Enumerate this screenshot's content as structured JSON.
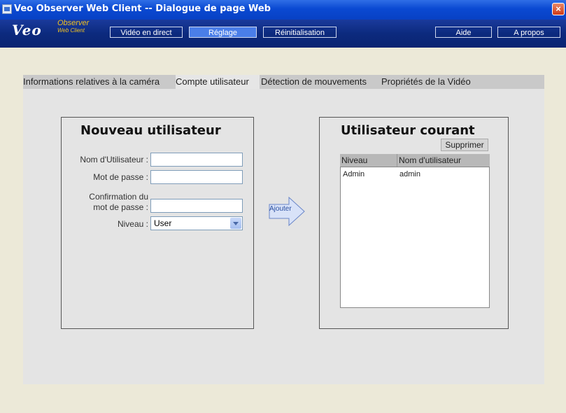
{
  "window": {
    "title": "Veo Observer Web Client -- Dialogue de page Web",
    "close_label": "×"
  },
  "logo": {
    "brand": "Veo",
    "line1": "Observer",
    "line2": "Web Client"
  },
  "nav": {
    "live_video": "Vidéo en direct",
    "settings": "Réglage",
    "reset": "Réinitialisation",
    "help": "Aide",
    "about": "A propos"
  },
  "tabs": [
    {
      "label": "Informations relatives à la caméra",
      "active": false
    },
    {
      "label": "Compte utilisateur",
      "active": true
    },
    {
      "label": "Détection de mouvements",
      "active": false
    },
    {
      "label": "Propriétés de la Vidéo",
      "active": false
    }
  ],
  "new_user": {
    "title": "Nouveau utilisateur",
    "username_label": "Nom d'Utilisateur :",
    "username_value": "",
    "password_label": "Mot de passe :",
    "password_value": "",
    "confirm_label_line1": "Confirmation du",
    "confirm_label_line2": "mot de passe :",
    "confirm_value": "",
    "level_label": "Niveau :",
    "level_value": "User"
  },
  "add_button": "Ajouter",
  "current_user": {
    "title": "Utilisateur courant",
    "delete_button": "Supprimer",
    "columns": [
      "Niveau",
      "Nom d'utilisateur"
    ],
    "rows": [
      {
        "level": "Admin",
        "name": "admin"
      }
    ]
  },
  "colors": {
    "titlebar": "#0a49d2",
    "navbar": "#0c2a7e",
    "active_nav": "#4a7ee8",
    "logo_accent": "#f0c020"
  }
}
